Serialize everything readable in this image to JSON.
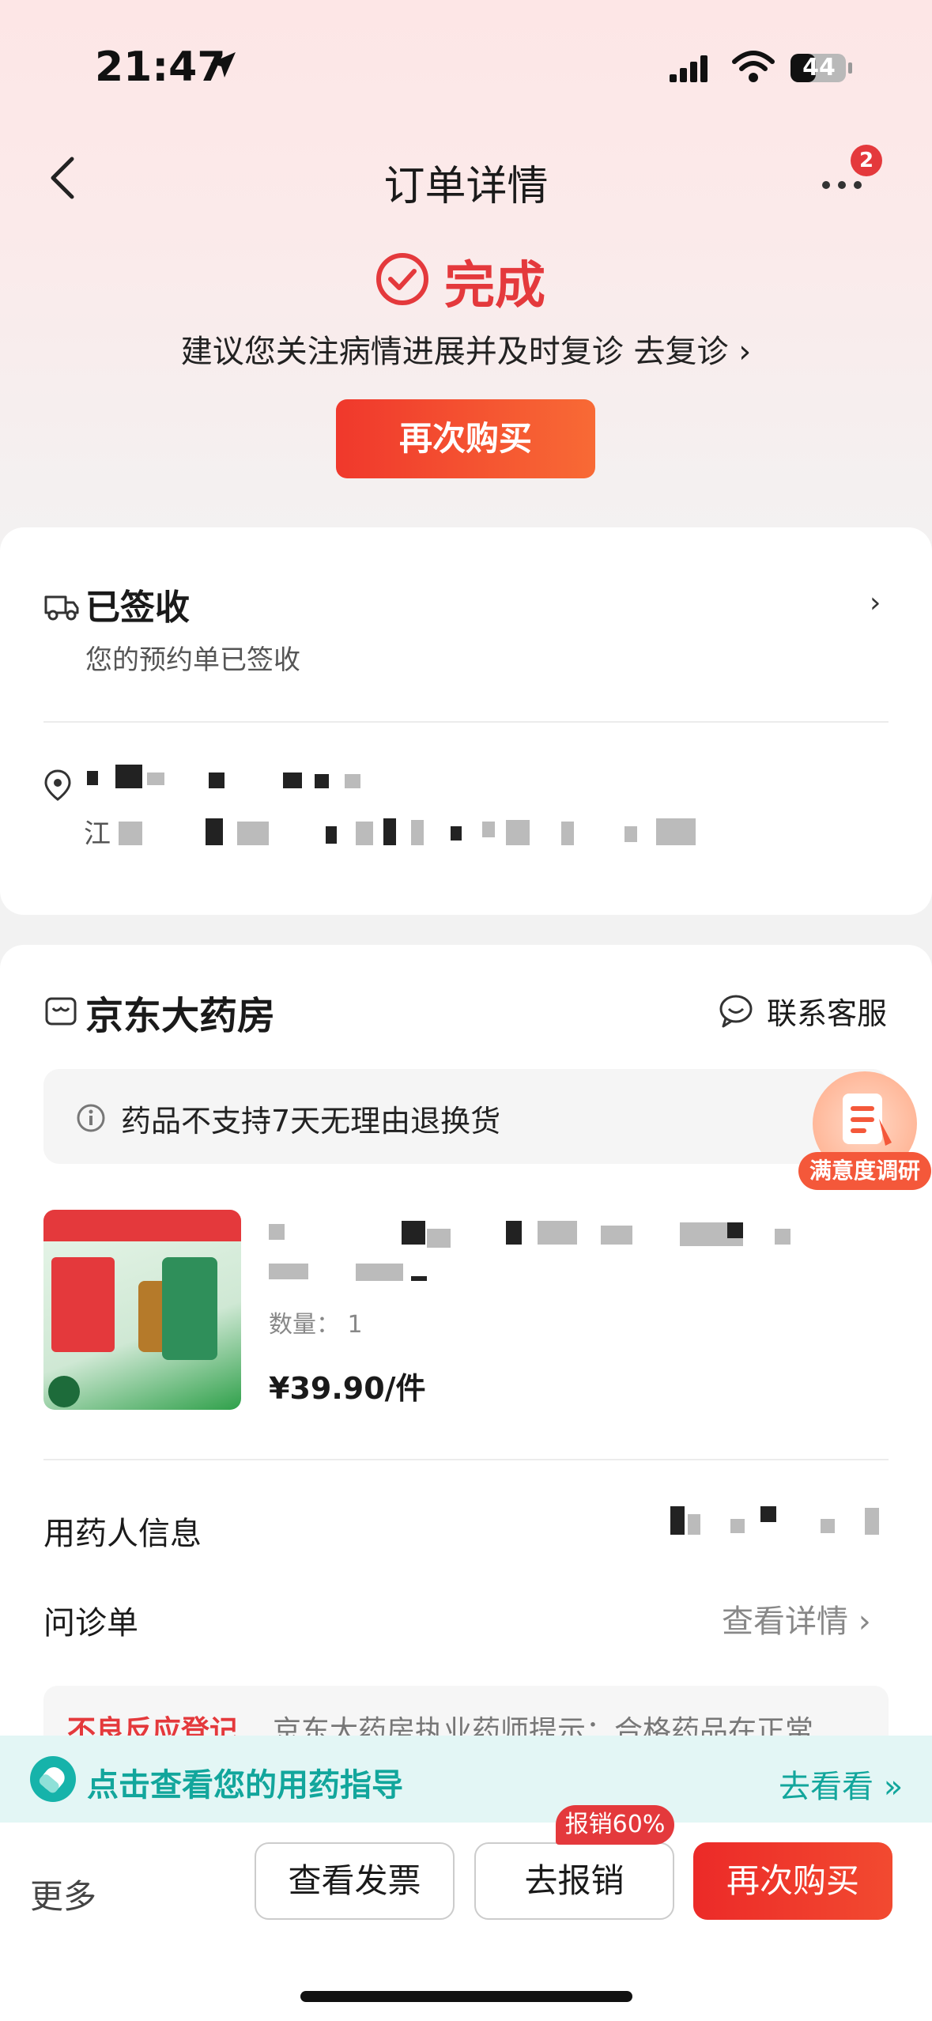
{
  "status_bar": {
    "time": "21:47",
    "battery": "44"
  },
  "nav": {
    "title": "订单详情",
    "more_badge": "2"
  },
  "order_status": {
    "label": "完成",
    "advice": "建议您关注病情进展并及时复诊 去复诊 ›",
    "rebuy_label": "再次购买"
  },
  "delivery": {
    "title": "已签收",
    "subtitle": "您的预约单已签收",
    "address_prefix": "江"
  },
  "shop": {
    "name": "京东大药房",
    "contact_label": "联系客服",
    "notice": "药品不支持7天无理由退换货"
  },
  "survey": {
    "label": "满意度调研"
  },
  "product": {
    "quantity_label": "数量： 1",
    "price": "¥39.90/件"
  },
  "rows": {
    "patient_label": "用药人信息",
    "consult_label": "问诊单",
    "consult_action": "查看详情 ›"
  },
  "tip": {
    "red": "不良反应登记",
    "gray": "京东大药房执业药师提示：合格药品在正常"
  },
  "guide": {
    "text": "点击查看您的用药指导",
    "go": "去看看 »"
  },
  "bottom_bar": {
    "more": "更多",
    "invoice": "查看发票",
    "reimburse": "去报销",
    "reimburse_badge": "报销60%",
    "rebuy": "再次购买"
  },
  "colors": {
    "accent_red": "#e4393c",
    "guide_teal": "#12a69c"
  }
}
